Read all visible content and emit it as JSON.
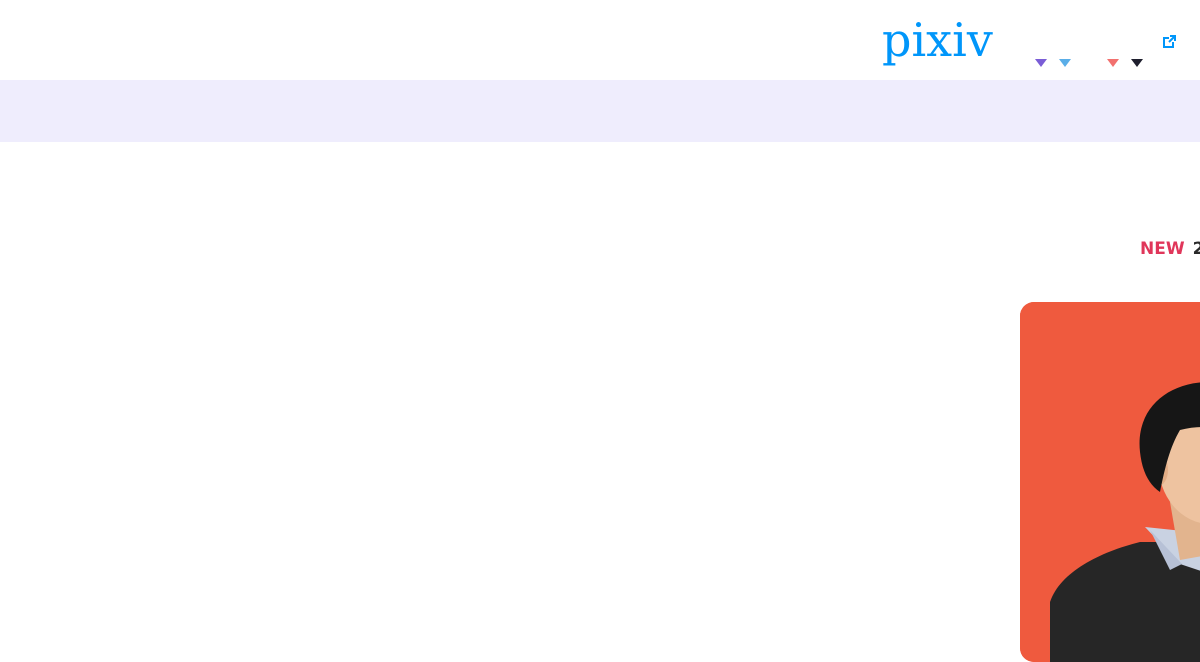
{
  "header": {
    "logo": {
      "wordmark": "pixiv",
      "icon": "pixiv-logo",
      "color": "#0096fa"
    },
    "dropdowns": [
      {
        "icon": "chevron-down-icon",
        "color": "#7a5dd6"
      },
      {
        "icon": "chevron-down-icon",
        "color": "#5aaee8"
      },
      {
        "icon": "chevron-down-icon",
        "color": "#f2716f"
      },
      {
        "icon": "chevron-down-icon",
        "color": "#1f1f2e"
      }
    ],
    "external_link": {
      "icon": "external-link-icon",
      "color": "#0096fa"
    }
  },
  "subnav": {
    "background": "#efedfd"
  },
  "news": {
    "badge": "NEW",
    "date_prefix": "2",
    "badge_color": "#e0365a"
  },
  "feature": {
    "card_color": "#ef5a3e",
    "image": "person-photo"
  }
}
